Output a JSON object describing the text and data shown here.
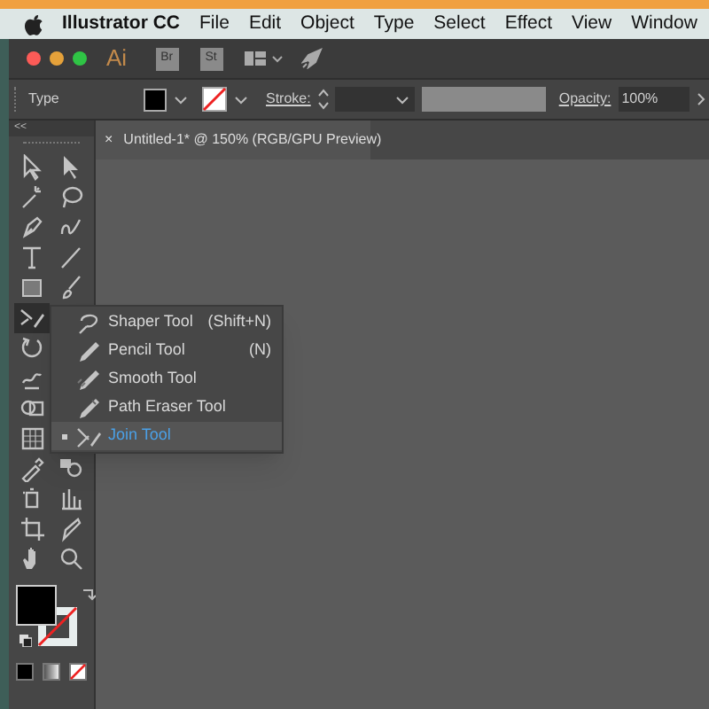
{
  "menu_bar": {
    "app_name": "Illustrator CC",
    "items": [
      "File",
      "Edit",
      "Object",
      "Type",
      "Select",
      "Effect",
      "View",
      "Window"
    ]
  },
  "app_bar": {
    "logo": "Ai",
    "buttons": [
      "Br",
      "St"
    ]
  },
  "control_bar": {
    "selection_label": "Type",
    "stroke_label": "Stroke:",
    "opacity_label": "Opacity:",
    "opacity_value": "100%"
  },
  "toolbox": {
    "collapse": "<<",
    "tool_rows": [
      [
        {
          "kind": "selection",
          "selected": false
        },
        {
          "kind": "direct-selection",
          "selected": false
        }
      ],
      [
        {
          "kind": "magic-wand",
          "selected": false
        },
        {
          "kind": "lasso",
          "selected": false
        }
      ],
      [
        {
          "kind": "pen",
          "selected": false
        },
        {
          "kind": "curvature",
          "selected": false
        }
      ],
      [
        {
          "kind": "type",
          "selected": false
        },
        {
          "kind": "line",
          "selected": false
        }
      ],
      [
        {
          "kind": "rectangle",
          "selected": false
        },
        {
          "kind": "paintbrush",
          "selected": false
        }
      ],
      [
        {
          "kind": "shaper",
          "selected": true
        }
      ],
      [
        {
          "kind": "rotate",
          "selected": false
        }
      ],
      [
        {
          "kind": "warp",
          "selected": false
        }
      ],
      [
        {
          "kind": "shape-builder",
          "selected": false
        }
      ],
      [
        {
          "kind": "mesh",
          "selected": false
        }
      ],
      [
        {
          "kind": "eyedropper",
          "selected": false
        },
        {
          "kind": "blend",
          "selected": false
        }
      ],
      [
        {
          "kind": "symbol-sprayer",
          "selected": false
        },
        {
          "kind": "graph",
          "selected": false
        }
      ],
      [
        {
          "kind": "artboard",
          "selected": false
        },
        {
          "kind": "slice",
          "selected": false
        }
      ],
      [
        {
          "kind": "hand",
          "selected": false
        },
        {
          "kind": "zoom",
          "selected": false
        }
      ]
    ]
  },
  "document_tab": {
    "close": "×",
    "title": "Untitled-1* @ 150% (RGB/GPU Preview)"
  },
  "flyout_menu": {
    "items": [
      {
        "label": "Shaper Tool",
        "shortcut": "(Shift+N)",
        "selected": false
      },
      {
        "label": "Pencil Tool",
        "shortcut": "(N)",
        "selected": false
      },
      {
        "label": "Smooth Tool",
        "selected": false
      },
      {
        "label": "Path Eraser Tool",
        "selected": false
      },
      {
        "label": "Join Tool",
        "selected": true
      }
    ]
  }
}
